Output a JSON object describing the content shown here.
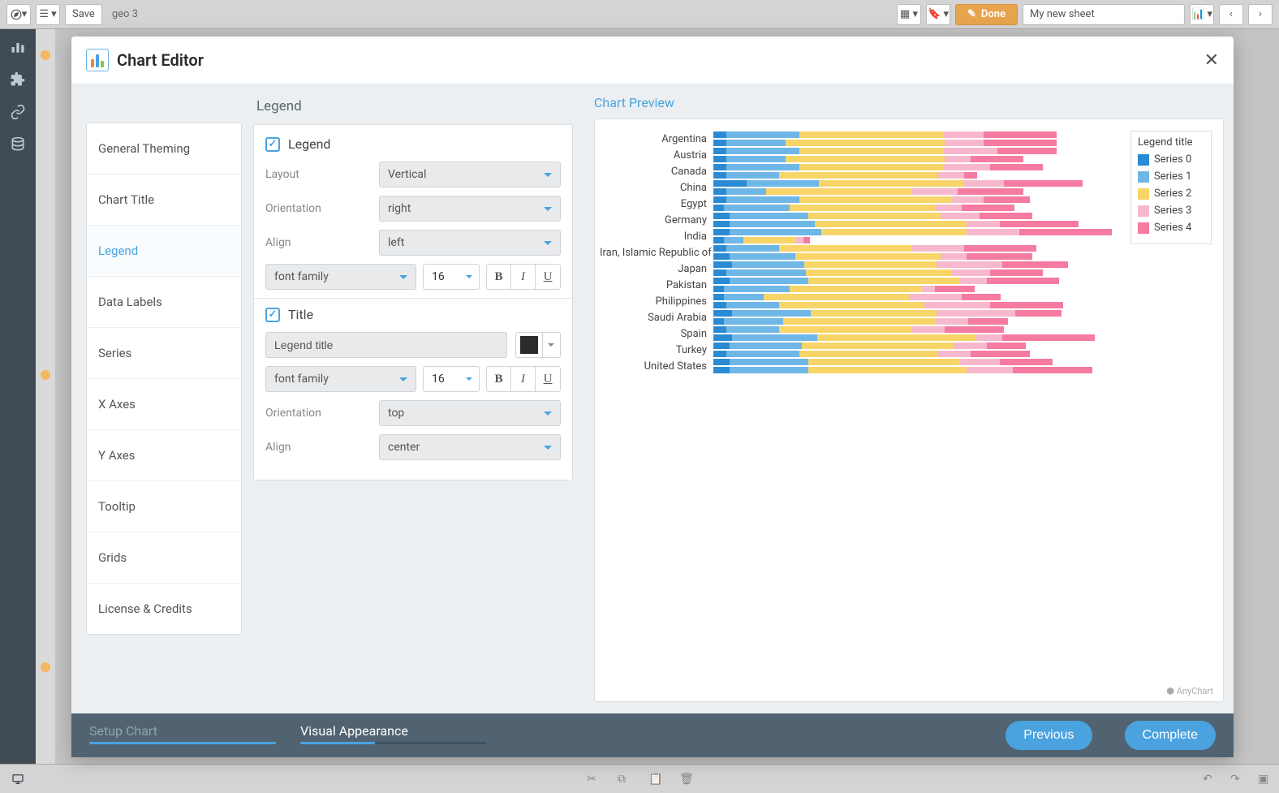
{
  "toolbar": {
    "save_label": "Save",
    "file_name": "geo 3",
    "done_label": "Done",
    "sheet_name": "My new sheet"
  },
  "modal": {
    "title": "Chart Editor",
    "nav_items": [
      "General Theming",
      "Chart Title",
      "Legend",
      "Data Labels",
      "Series",
      "X Axes",
      "Y Axes",
      "Tooltip",
      "Grids",
      "License & Credits"
    ],
    "active_nav": 2,
    "panel_title": "Legend",
    "preview_title": "Chart Preview",
    "legend": {
      "check_label": "Legend",
      "layout_label": "Layout",
      "layout_value": "Vertical",
      "orientation_label": "Orientation",
      "orientation_value": "right",
      "align_label": "Align",
      "align_value": "left",
      "font_family": "font family",
      "font_size": "16"
    },
    "title_section": {
      "check_label": "Title",
      "title_value": "Legend title",
      "color": "#2b2b2b",
      "font_family": "font family",
      "font_size": "16",
      "orientation_label": "Orientation",
      "orientation_value": "top",
      "align_label": "Align",
      "align_value": "center"
    },
    "footer": {
      "step1": "Setup Chart",
      "step2": "Visual Appearance",
      "prev": "Previous",
      "complete": "Complete"
    },
    "watermark": "⬢ AnyChart"
  },
  "chart_data": {
    "type": "bar",
    "title": "",
    "legend_title": "Legend title",
    "series_names": [
      "Series 0",
      "Series 1",
      "Series 2",
      "Series 3",
      "Series 4"
    ],
    "colors": [
      "#2a8bd4",
      "#6fb7e6",
      "#f8d568",
      "#f7b8ce",
      "#f57ba0"
    ],
    "categories": [
      "Argentina",
      "Austria",
      "Canada",
      "China",
      "Egypt",
      "Germany",
      "India",
      "Iran, Islamic Republic of",
      "Japan",
      "Pakistan",
      "Philippines",
      "Saudi Arabia",
      "Spain",
      "Turkey",
      "United States"
    ],
    "bars_per_category": 2,
    "data": {
      "Argentina": [
        [
          10,
          55,
          110,
          30,
          55
        ],
        [
          10,
          45,
          120,
          30,
          55
        ]
      ],
      "Austria": [
        [
          10,
          55,
          110,
          40,
          45
        ],
        [
          10,
          45,
          120,
          20,
          40
        ]
      ],
      "Canada": [
        [
          10,
          55,
          110,
          35,
          40
        ],
        [
          10,
          40,
          120,
          20,
          10
        ]
      ],
      "China": [
        [
          25,
          55,
          110,
          30,
          60
        ],
        [
          10,
          30,
          110,
          35,
          50
        ]
      ],
      "Egypt": [
        [
          10,
          55,
          115,
          25,
          35
        ],
        [
          8,
          50,
          110,
          20,
          40
        ]
      ],
      "Germany": [
        [
          12,
          60,
          100,
          30,
          40
        ],
        [
          12,
          65,
          115,
          25,
          60
        ]
      ],
      "India": [
        [
          12,
          70,
          110,
          40,
          70
        ],
        [
          8,
          15,
          40,
          5,
          5
        ]
      ],
      "Iran, Islamic Republic of": [
        [
          10,
          40,
          100,
          40,
          55
        ],
        [
          12,
          50,
          110,
          20,
          50
        ]
      ],
      "Japan": [
        [
          14,
          55,
          100,
          50,
          50
        ],
        [
          10,
          60,
          110,
          30,
          40
        ]
      ],
      "Pakistan": [
        [
          12,
          60,
          115,
          20,
          55
        ],
        [
          8,
          50,
          100,
          10,
          30
        ]
      ],
      "Philippines": [
        [
          8,
          30,
          110,
          40,
          30
        ],
        [
          10,
          40,
          110,
          50,
          55
        ]
      ],
      "Saudi Arabia": [
        [
          14,
          60,
          95,
          60,
          35
        ],
        [
          8,
          45,
          115,
          25,
          30
        ]
      ],
      "Spain": [
        [
          10,
          40,
          100,
          25,
          45
        ],
        [
          14,
          65,
          120,
          20,
          70
        ]
      ],
      "Turkey": [
        [
          12,
          55,
          115,
          25,
          30
        ],
        [
          10,
          55,
          105,
          25,
          45
        ]
      ],
      "United States": [
        [
          12,
          60,
          115,
          30,
          40
        ],
        [
          12,
          60,
          120,
          35,
          60
        ]
      ]
    },
    "max_total": 310
  }
}
